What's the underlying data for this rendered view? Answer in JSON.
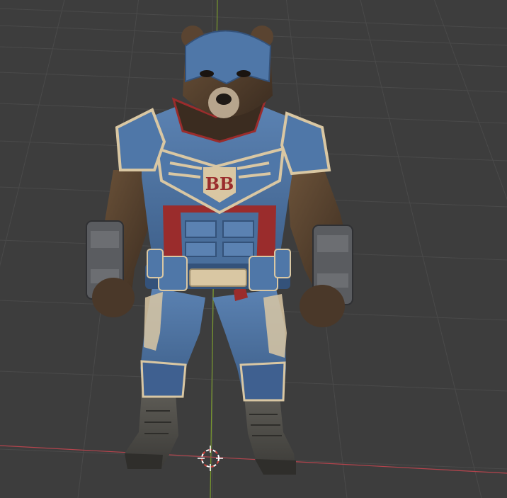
{
  "viewport": {
    "background_color": "#3d3d3d",
    "grid_line_color": "#4a4a4a",
    "x_axis_color": "#b5444d",
    "y_axis_color": "#7a9a2e"
  },
  "model": {
    "emblem_text": "BB",
    "colors": {
      "suit_blue": "#4a6f9c",
      "suit_blue_dark": "#34527a",
      "trim_tan": "#d9c7a3",
      "accent_red": "#9a2c2c",
      "fur_brown": "#5a4431",
      "fur_dark": "#3b2c20",
      "boot_gray": "#4e4d48",
      "armor_gray": "#5a5c60"
    }
  },
  "cursor": {
    "icon": "3d-cursor-icon",
    "colors": [
      "#ffffff",
      "#d2413a"
    ]
  }
}
